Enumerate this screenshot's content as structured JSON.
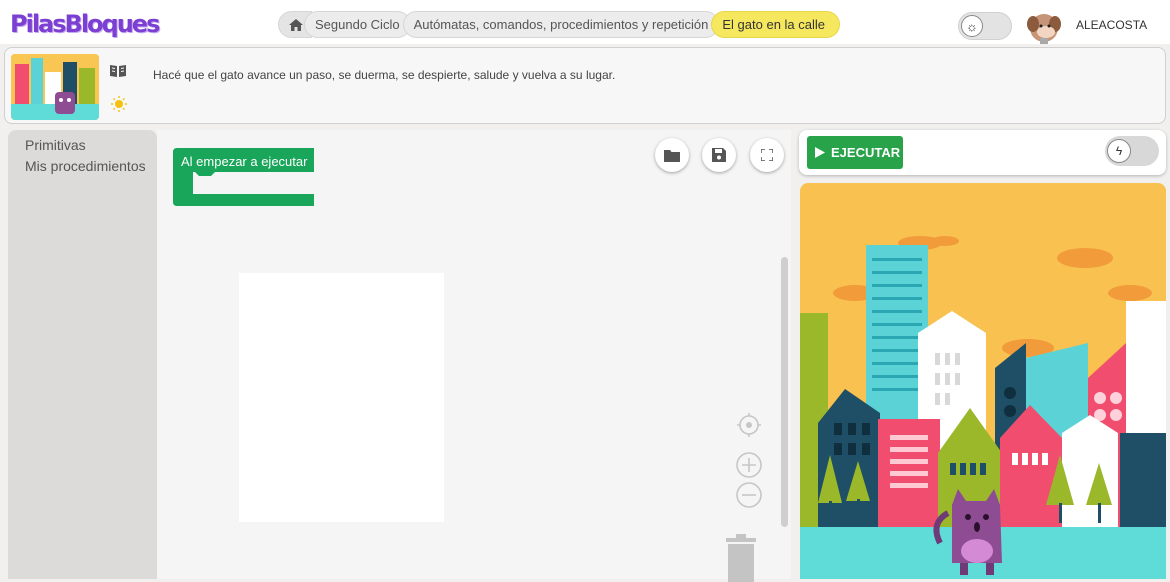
{
  "app": {
    "logo": "PilasBloques",
    "username": "ALEACOSTA"
  },
  "breadcrumb": [
    {
      "label": "Segundo Ciclo"
    },
    {
      "label": "Autómatas, comandos, procedimientos y repetición"
    },
    {
      "label": "El gato en la calle"
    }
  ],
  "challenge": {
    "description": "Hacé que el gato avance un paso, se duerma, se despierte, salude y vuelva a su lugar."
  },
  "palette": {
    "items": [
      "Primitivas",
      "Mis procedimientos"
    ]
  },
  "workspace": {
    "block_label": "Al empezar a ejecutar"
  },
  "run": {
    "label": "EJECUTAR"
  },
  "colors": {
    "accent": "#29a34a",
    "brand": "#7b3fd1",
    "active_crumb": "#f6e85e"
  },
  "icons": [
    "home-icon",
    "theme-toggle-icon",
    "book-icon",
    "bulb-icon",
    "folder-icon",
    "save-icon",
    "fullscreen-icon",
    "center-icon",
    "zoom-in-icon",
    "zoom-out-icon",
    "trash-icon",
    "play-icon",
    "turbo-icon"
  ]
}
